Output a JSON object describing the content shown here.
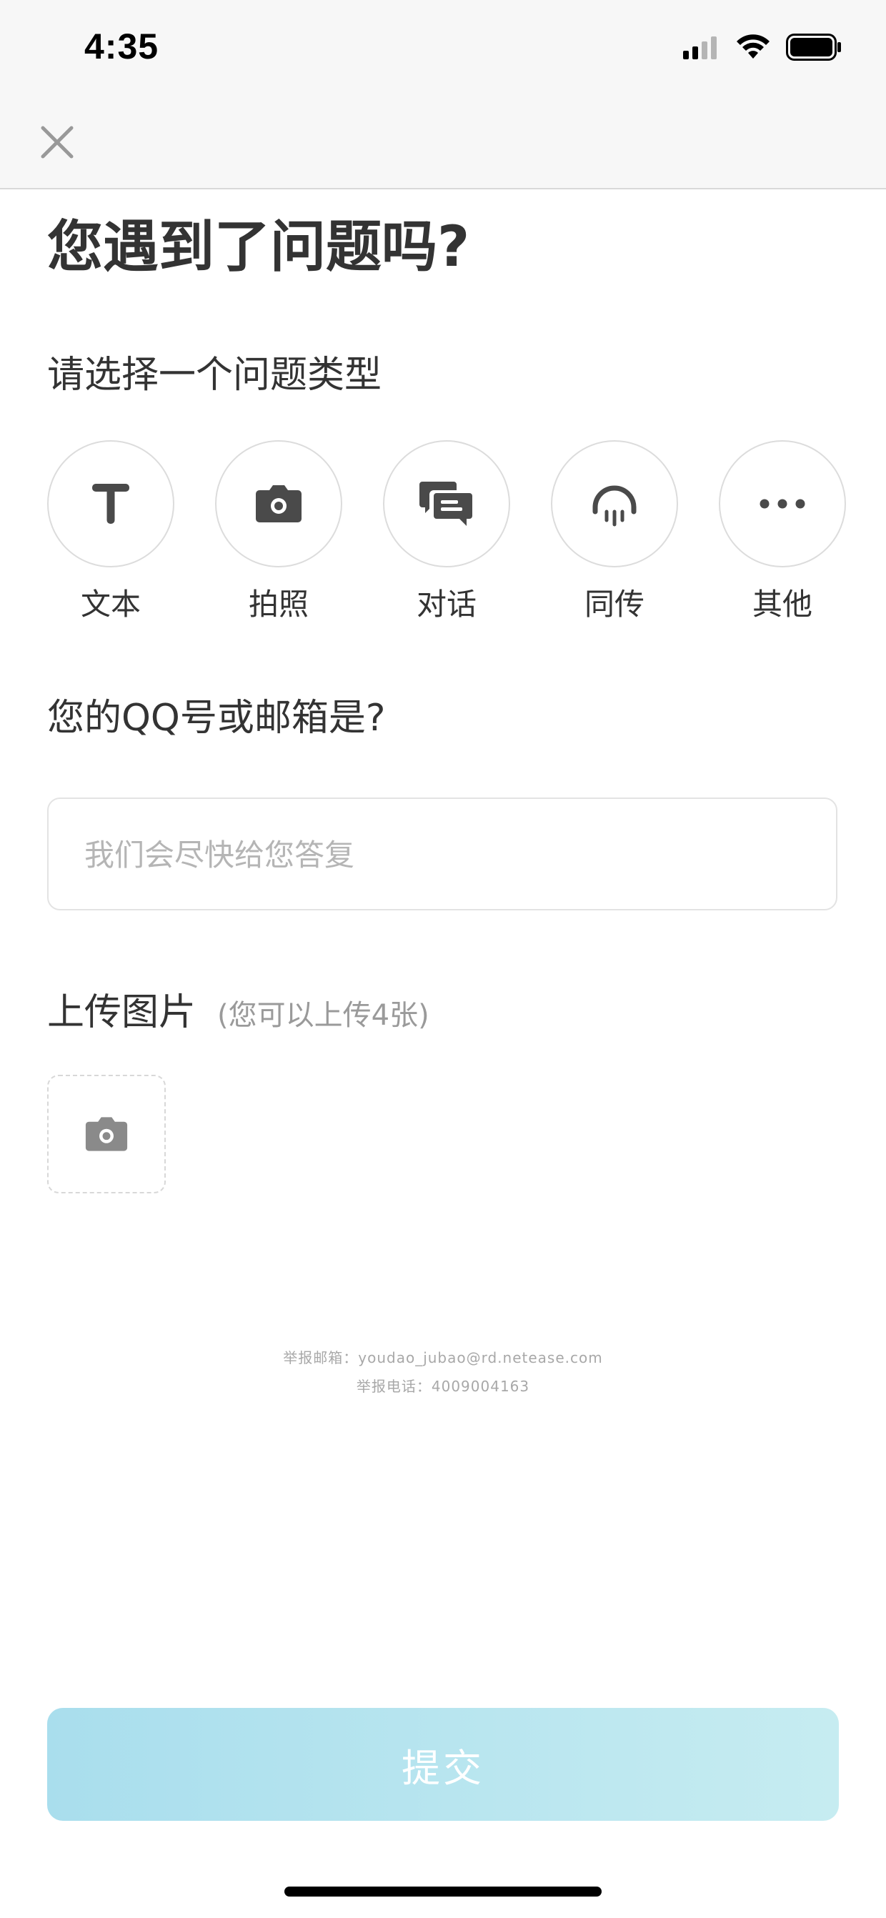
{
  "status_bar": {
    "time": "4:35",
    "icons": [
      "cellular-signal-icon",
      "wifi-icon",
      "battery-icon"
    ]
  },
  "nav": {
    "close_icon": "close-icon"
  },
  "title": "您遇到了问题吗?",
  "problem_type": {
    "label": "请选择一个问题类型",
    "types": [
      {
        "label": "文本",
        "icon": "text-icon"
      },
      {
        "label": "拍照",
        "icon": "camera-icon"
      },
      {
        "label": "对话",
        "icon": "chat-icon"
      },
      {
        "label": "同传",
        "icon": "simultaneous-interpretation-icon"
      },
      {
        "label": "其他",
        "icon": "more-icon"
      }
    ]
  },
  "contact": {
    "label": "您的QQ号或邮箱是?",
    "placeholder": "我们会尽快给您答复",
    "value": ""
  },
  "upload": {
    "title": "上传图片",
    "hint": "(您可以上传4张)",
    "icon": "camera-icon"
  },
  "report": {
    "email": "举报邮箱：youdao_jubao@rd.netease.com",
    "phone": "举报电话：4009004163"
  },
  "submit": {
    "label": "提交"
  },
  "colors": {
    "submit_gradient_start": "#a9deed",
    "submit_gradient_end": "#c6ecf1",
    "icon_dark": "#4a4a4a",
    "icon_gray": "#8a8a8a"
  }
}
